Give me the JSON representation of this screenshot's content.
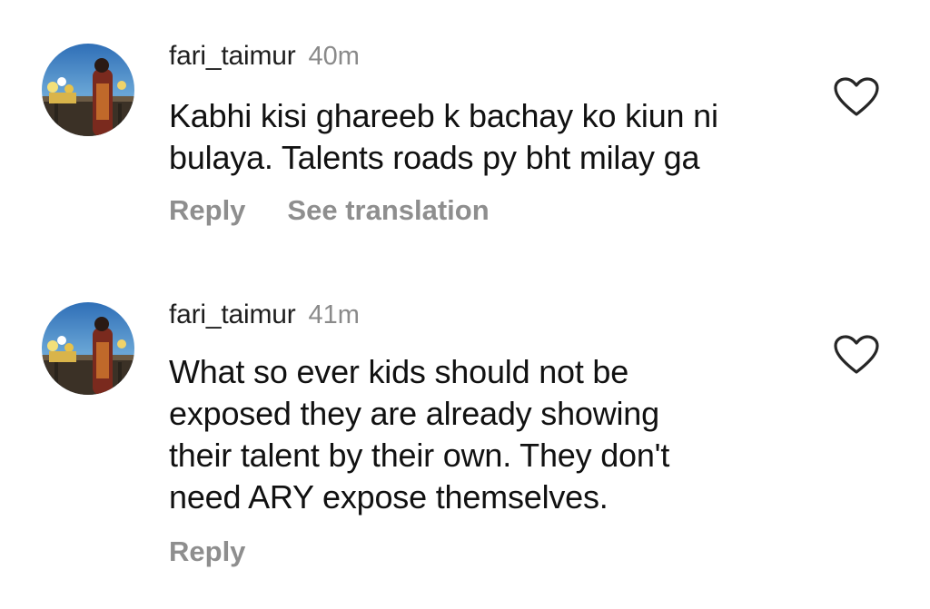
{
  "comments": [
    {
      "username": "fari_taimur",
      "time": "40m",
      "text_lines": [
        "Kabhi kisi ghareeb k bachay ko kiun ni",
        "bulaya. Talents roads py bht milay ga"
      ],
      "actions": {
        "reply": "Reply",
        "see_translation": "See translation"
      },
      "avatar_icon": "avatar-photo",
      "like_icon": "heart-outline-icon"
    },
    {
      "username": "fari_taimur",
      "time": "41m",
      "text_lines": [
        "What so ever kids should not be",
        "exposed they are already showing",
        "their talent by their own. They don't",
        "need ARY expose themselves."
      ],
      "actions": {
        "reply": "Reply"
      },
      "avatar_icon": "avatar-photo",
      "like_icon": "heart-outline-icon"
    }
  ],
  "colors": {
    "username": "#1f1f1f",
    "timestamp": "#8a8a8a",
    "action": "#8e8e8e",
    "body_text": "#111111",
    "heart_stroke": "#262626"
  }
}
